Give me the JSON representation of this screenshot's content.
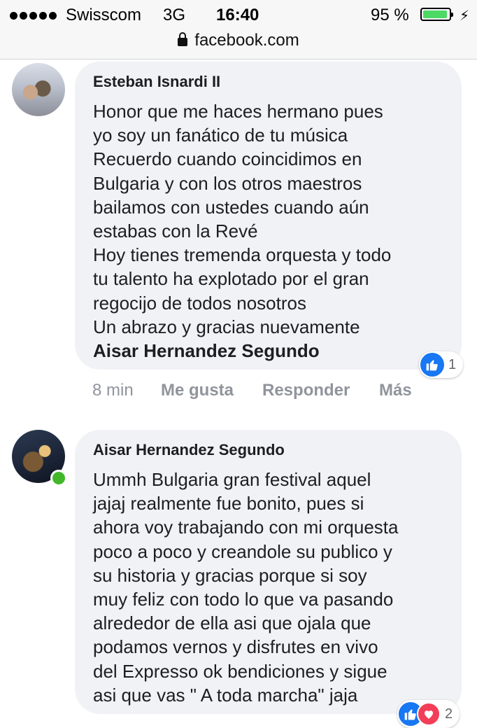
{
  "status_bar": {
    "carrier": "Swisscom",
    "network": "3G",
    "time": "16:40",
    "battery_percent": "95 %",
    "battery_level": 0.95,
    "charging_icon": "bolt-icon"
  },
  "url_bar": {
    "domain": "facebook.com",
    "lock_icon": "lock-icon"
  },
  "comments": [
    {
      "author": "Esteban Isnardi II",
      "text": "Honor que me haces hermano pues\nyo soy un fanático de tu música\nRecuerdo cuando coincidimos en\nBulgaria y con los otros maestros\nbailamos con ustedes cuando aún\nestabas con la Revé\nHoy tienes tremenda orquesta y todo\ntu talento ha explotado por el gran\nregocijo de todos nosotros\nUn abrazo y gracias nuevamente",
      "mention": "Aisar Hernandez Segundo",
      "reaction_count": "1",
      "reaction_icon": "like-icon",
      "time": "8 min",
      "like_label": "Me gusta",
      "reply_label": "Responder",
      "more_label": "Más"
    },
    {
      "author": "Aisar Hernandez Segundo",
      "online": true,
      "text": "Ummh Bulgaria gran festival aquel\njajaj realmente fue bonito, pues si\nahora voy trabajando con mi orquesta\npoco a poco y creandole su publico y\nsu historia y gracias porque si soy\nmuy feliz con todo lo que va pasando\nalrededor de ella asi que ojala que\npodamos vernos y disfrutes en vivo\ndel Expresso ok bendiciones y sigue\nasi que vas \" A toda marcha\" jaja",
      "reaction_count": "2",
      "reaction_icons": [
        "like-icon",
        "love-icon"
      ]
    }
  ],
  "colors": {
    "bubble": "#f0f2f5",
    "like_blue": "#1877f2",
    "love_red": "#f33e58",
    "online_green": "#42b72a",
    "battery_green": "#4cd964"
  }
}
